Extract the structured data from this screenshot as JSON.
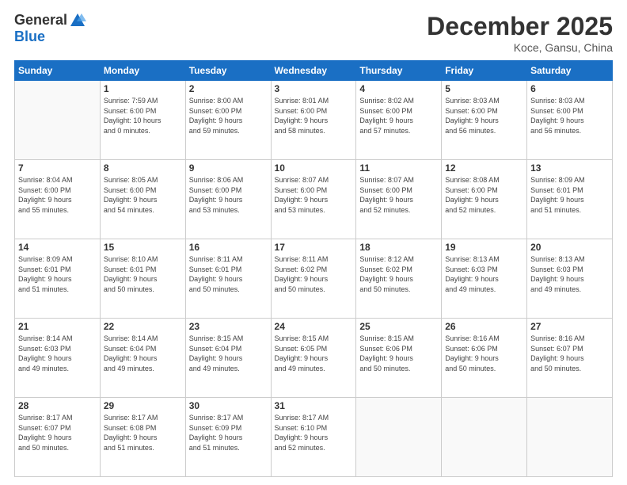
{
  "header": {
    "logo_general": "General",
    "logo_blue": "Blue",
    "month_title": "December 2025",
    "location": "Koce, Gansu, China"
  },
  "weekdays": [
    "Sunday",
    "Monday",
    "Tuesday",
    "Wednesday",
    "Thursday",
    "Friday",
    "Saturday"
  ],
  "weeks": [
    [
      {
        "day": "",
        "info": ""
      },
      {
        "day": "1",
        "info": "Sunrise: 7:59 AM\nSunset: 6:00 PM\nDaylight: 10 hours\nand 0 minutes."
      },
      {
        "day": "2",
        "info": "Sunrise: 8:00 AM\nSunset: 6:00 PM\nDaylight: 9 hours\nand 59 minutes."
      },
      {
        "day": "3",
        "info": "Sunrise: 8:01 AM\nSunset: 6:00 PM\nDaylight: 9 hours\nand 58 minutes."
      },
      {
        "day": "4",
        "info": "Sunrise: 8:02 AM\nSunset: 6:00 PM\nDaylight: 9 hours\nand 57 minutes."
      },
      {
        "day": "5",
        "info": "Sunrise: 8:03 AM\nSunset: 6:00 PM\nDaylight: 9 hours\nand 56 minutes."
      },
      {
        "day": "6",
        "info": "Sunrise: 8:03 AM\nSunset: 6:00 PM\nDaylight: 9 hours\nand 56 minutes."
      }
    ],
    [
      {
        "day": "7",
        "info": "Sunrise: 8:04 AM\nSunset: 6:00 PM\nDaylight: 9 hours\nand 55 minutes."
      },
      {
        "day": "8",
        "info": "Sunrise: 8:05 AM\nSunset: 6:00 PM\nDaylight: 9 hours\nand 54 minutes."
      },
      {
        "day": "9",
        "info": "Sunrise: 8:06 AM\nSunset: 6:00 PM\nDaylight: 9 hours\nand 53 minutes."
      },
      {
        "day": "10",
        "info": "Sunrise: 8:07 AM\nSunset: 6:00 PM\nDaylight: 9 hours\nand 53 minutes."
      },
      {
        "day": "11",
        "info": "Sunrise: 8:07 AM\nSunset: 6:00 PM\nDaylight: 9 hours\nand 52 minutes."
      },
      {
        "day": "12",
        "info": "Sunrise: 8:08 AM\nSunset: 6:00 PM\nDaylight: 9 hours\nand 52 minutes."
      },
      {
        "day": "13",
        "info": "Sunrise: 8:09 AM\nSunset: 6:01 PM\nDaylight: 9 hours\nand 51 minutes."
      }
    ],
    [
      {
        "day": "14",
        "info": "Sunrise: 8:09 AM\nSunset: 6:01 PM\nDaylight: 9 hours\nand 51 minutes."
      },
      {
        "day": "15",
        "info": "Sunrise: 8:10 AM\nSunset: 6:01 PM\nDaylight: 9 hours\nand 50 minutes."
      },
      {
        "day": "16",
        "info": "Sunrise: 8:11 AM\nSunset: 6:01 PM\nDaylight: 9 hours\nand 50 minutes."
      },
      {
        "day": "17",
        "info": "Sunrise: 8:11 AM\nSunset: 6:02 PM\nDaylight: 9 hours\nand 50 minutes."
      },
      {
        "day": "18",
        "info": "Sunrise: 8:12 AM\nSunset: 6:02 PM\nDaylight: 9 hours\nand 50 minutes."
      },
      {
        "day": "19",
        "info": "Sunrise: 8:13 AM\nSunset: 6:03 PM\nDaylight: 9 hours\nand 49 minutes."
      },
      {
        "day": "20",
        "info": "Sunrise: 8:13 AM\nSunset: 6:03 PM\nDaylight: 9 hours\nand 49 minutes."
      }
    ],
    [
      {
        "day": "21",
        "info": "Sunrise: 8:14 AM\nSunset: 6:03 PM\nDaylight: 9 hours\nand 49 minutes."
      },
      {
        "day": "22",
        "info": "Sunrise: 8:14 AM\nSunset: 6:04 PM\nDaylight: 9 hours\nand 49 minutes."
      },
      {
        "day": "23",
        "info": "Sunrise: 8:15 AM\nSunset: 6:04 PM\nDaylight: 9 hours\nand 49 minutes."
      },
      {
        "day": "24",
        "info": "Sunrise: 8:15 AM\nSunset: 6:05 PM\nDaylight: 9 hours\nand 49 minutes."
      },
      {
        "day": "25",
        "info": "Sunrise: 8:15 AM\nSunset: 6:06 PM\nDaylight: 9 hours\nand 50 minutes."
      },
      {
        "day": "26",
        "info": "Sunrise: 8:16 AM\nSunset: 6:06 PM\nDaylight: 9 hours\nand 50 minutes."
      },
      {
        "day": "27",
        "info": "Sunrise: 8:16 AM\nSunset: 6:07 PM\nDaylight: 9 hours\nand 50 minutes."
      }
    ],
    [
      {
        "day": "28",
        "info": "Sunrise: 8:17 AM\nSunset: 6:07 PM\nDaylight: 9 hours\nand 50 minutes."
      },
      {
        "day": "29",
        "info": "Sunrise: 8:17 AM\nSunset: 6:08 PM\nDaylight: 9 hours\nand 51 minutes."
      },
      {
        "day": "30",
        "info": "Sunrise: 8:17 AM\nSunset: 6:09 PM\nDaylight: 9 hours\nand 51 minutes."
      },
      {
        "day": "31",
        "info": "Sunrise: 8:17 AM\nSunset: 6:10 PM\nDaylight: 9 hours\nand 52 minutes."
      },
      {
        "day": "",
        "info": ""
      },
      {
        "day": "",
        "info": ""
      },
      {
        "day": "",
        "info": ""
      }
    ]
  ]
}
